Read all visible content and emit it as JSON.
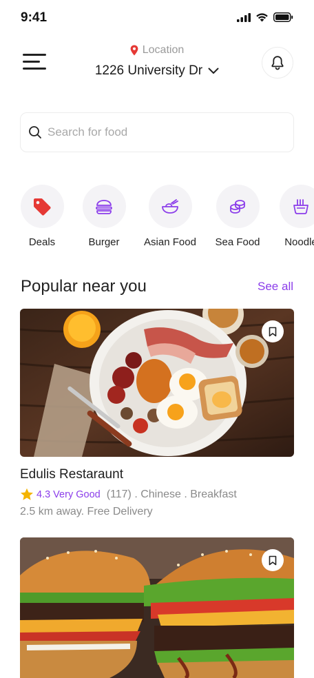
{
  "status_bar": {
    "time": "9:41"
  },
  "header": {
    "location_label": "Location",
    "address": "1226 University Dr"
  },
  "search": {
    "placeholder": "Search for food"
  },
  "categories": [
    {
      "label": "Deals",
      "icon": "tag-icon"
    },
    {
      "label": "Burger",
      "icon": "burger-icon"
    },
    {
      "label": "Asian Food",
      "icon": "bowl-icon"
    },
    {
      "label": "Sea Food",
      "icon": "seafood-icon"
    },
    {
      "label": "Noodle",
      "icon": "noodle-icon"
    }
  ],
  "popular": {
    "title": "Popular near you",
    "see_all": "See all",
    "restaurants": [
      {
        "name": "Edulis Restaraunt",
        "rating": "4.3 Very Good",
        "details": "(117) . Chinese . Breakfast",
        "delivery": "2.5 km away. Free Delivery",
        "image": "breakfast-plate-photo"
      },
      {
        "image": "burgers-photo"
      }
    ]
  },
  "colors": {
    "accent": "#8b3dea",
    "location_pin": "#e53935",
    "star": "#f4b400",
    "category_bg": "#f4f3f6"
  }
}
